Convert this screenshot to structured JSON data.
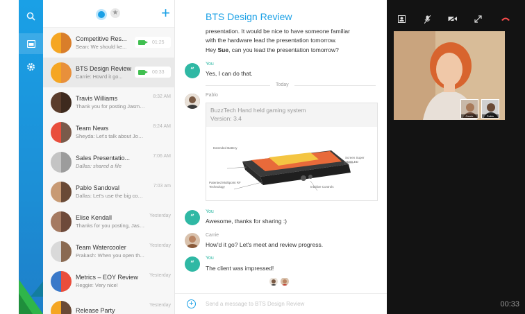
{
  "sidebar": {
    "icons": [
      "search-icon",
      "messages-icon",
      "settings-icon"
    ]
  },
  "list": {
    "items": [
      {
        "title": "Competitive Res...",
        "preview": "Sean: We should ke...",
        "time": "01:25",
        "call": true,
        "colors": [
          "#f5a623",
          "#d97e2a"
        ]
      },
      {
        "title": "BTS Design Review",
        "preview": "Carrie: How'd it go...",
        "time": "00:33",
        "call": true,
        "colors": [
          "#f5a623",
          "#e8903b"
        ]
      },
      {
        "title": "Travis Williams",
        "preview": "Thank you for posting Jasmine.",
        "time": "8:32 AM",
        "call": false,
        "colors": [
          "#5b3d2c",
          "#3e2a1e"
        ]
      },
      {
        "title": "Team News",
        "preview": "Sheyda: Let's talk about Jon...",
        "time": "8:24 AM",
        "call": false,
        "colors": [
          "#e94e3c",
          "#7a5a4a"
        ]
      },
      {
        "title": "Sales Presentatio...",
        "preview": "Dallas: shared a file",
        "time": "7:06 AM",
        "call": false,
        "colors": [
          "#c4c4c4",
          "#9c9c9c"
        ]
      },
      {
        "title": "Pablo Sandoval",
        "preview": "Dallas: Let's use the big confere...",
        "time": "7:03 am",
        "call": false,
        "colors": [
          "#c89a74",
          "#6a4a36"
        ]
      },
      {
        "title": "Elise Kendall",
        "preview": "Thanks for you posting, Jasmine.",
        "time": "Yesterday",
        "call": false,
        "colors": [
          "#a57a62",
          "#6e4a3a"
        ]
      },
      {
        "title": "Team Watercooler",
        "preview": "Prakash: When you open th...",
        "time": "Yesterday",
        "call": false,
        "colors": [
          "#d9d9d9",
          "#8a6a52"
        ]
      },
      {
        "title": "Metrics – EOY Review",
        "preview": "Reggie: Very nice!",
        "time": "Yesterday",
        "call": false,
        "colors": [
          "#3a79c9",
          "#e94e3c"
        ]
      },
      {
        "title": "Release Party",
        "preview": "",
        "time": "Yesterday",
        "call": false,
        "colors": [
          "#f5a623",
          "#6a4a36"
        ]
      }
    ]
  },
  "chat": {
    "title": "BTS Design Review",
    "top_line1": "presentation. It would be nice to have someone familiar",
    "top_line2": "with the hardware lead the presentation tomorrow.",
    "top_line3_pre": "Hey ",
    "top_line3_bold": "Sue",
    "top_line3_post": ", can you lead the presentation tomorrow?",
    "you_label": "You",
    "msg_you1": "Yes, I can do that.",
    "divider": "Today",
    "pablo_label": "Pablo",
    "card_title": "BuzzTech Hand held gaming system",
    "card_version": "Version: 3.4",
    "callout_extended": "Extended Battery",
    "callout_screen": "Screen Super AMOLED",
    "callout_patented": "Patented Multipoint RF Technology",
    "callout_intuitive": "Intuitive Controls",
    "msg_you2": "Awesome, thanks for sharing :)",
    "carrie_label": "Carrie",
    "msg_carrie": "How'd it go? Let's meet and review progress.",
    "msg_you3": "The client was impressed!",
    "composer_placeholder": "Send a message to BTS Design Review",
    "bubble_glyph": "“"
  },
  "video": {
    "timer": "00:33",
    "thumb1_label": "Carrie",
    "thumb2_label": "Pablo"
  }
}
